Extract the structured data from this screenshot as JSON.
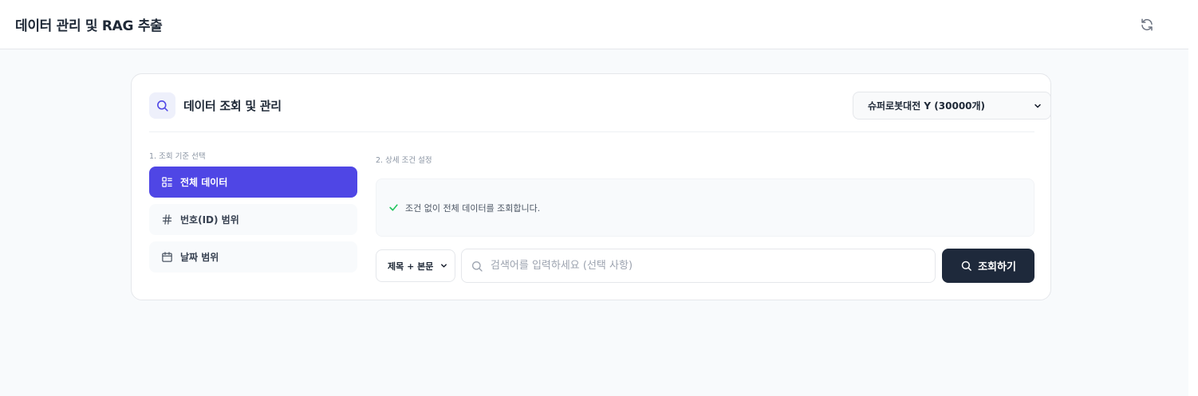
{
  "header": {
    "title": "데이터 관리 및 RAG 추출",
    "refresh_icon": "refresh-icon"
  },
  "card": {
    "icon": "search-icon",
    "title": "데이터 조회 및 관리",
    "dataset_select": {
      "selected": "슈퍼로봇대전 Y (30000개)"
    }
  },
  "criteria": {
    "label": "1. 조회 기준 선택",
    "items": [
      {
        "label": "전체 데이터",
        "icon": "list-icon",
        "active": true
      },
      {
        "label": "번호(ID) 범위",
        "icon": "hash-icon",
        "active": false
      },
      {
        "label": "날짜 범위",
        "icon": "calendar-icon",
        "active": false
      }
    ]
  },
  "details": {
    "label": "2. 상세 조건 설정",
    "info_text": "조건 없이 전체 데이터를 조회합니다.",
    "info_icon": "check-icon"
  },
  "search": {
    "scope_selected": "제목 + 본문",
    "input_value": "",
    "placeholder": "검색어를 입력하세요 (선택 사항)",
    "button_label": "조회하기"
  },
  "colors": {
    "accent": "#4f46e5",
    "dark_button": "#1e293b",
    "success_check": "#22c55e"
  }
}
